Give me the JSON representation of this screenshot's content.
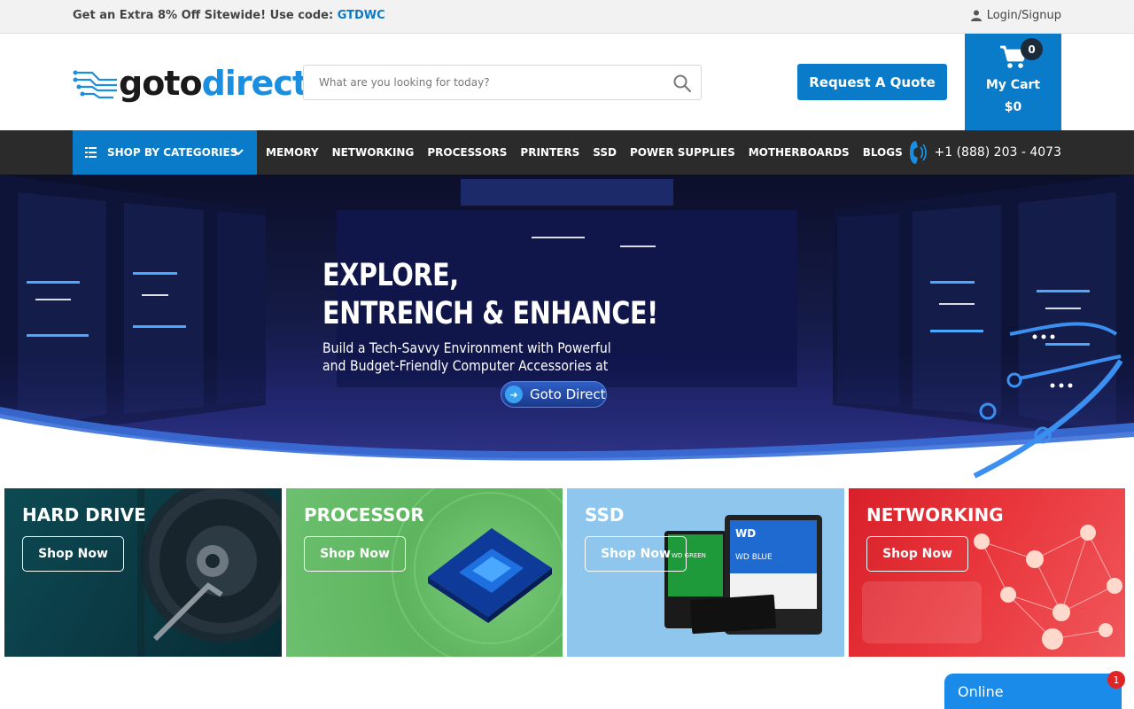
{
  "topbar": {
    "promo_text": "Get an Extra 8% Off Sitewide! Use code: ",
    "promo_code": "GTDWC",
    "login_label": "Login/Signup"
  },
  "header": {
    "logo_goto": "goto",
    "logo_direct": "direct",
    "search_placeholder": "What are you looking for today?",
    "quote_label": "Request A Quote",
    "cart_count": "0",
    "cart_label": "My Cart",
    "cart_total": "$0"
  },
  "nav": {
    "shop_by_categories": "SHOP BY CATEGORIES",
    "links": [
      "MEMORY",
      "NETWORKING",
      "PROCESSORS",
      "PRINTERS",
      "SSD",
      "POWER SUPPLIES",
      "MOTHERBOARDS",
      "BLOGS"
    ],
    "phone": "+1 (888) 203 - 4073"
  },
  "hero": {
    "title_line1": "EXPLORE,",
    "title_line2": "ENTRENCH & ENHANCE!",
    "sub_line1": "Build a Tech-Savvy Environment with Powerful",
    "sub_line2": "and Budget-Friendly Computer Accessories at",
    "cta_label": "Goto Direct"
  },
  "tiles": [
    {
      "title": "HARD DRIVE",
      "button": "Shop Now"
    },
    {
      "title": "PROCESSOR",
      "button": "Shop Now"
    },
    {
      "title": "SSD",
      "button": "Shop Now"
    },
    {
      "title": "NETWORKING",
      "button": "Shop Now"
    }
  ],
  "ssd_image_labels": {
    "wd_blue": "WD BLUE",
    "wd_green": "WD GREEN"
  },
  "chat": {
    "label": "Online",
    "badge": "1"
  },
  "colors": {
    "brand_blue": "#0a7bc8",
    "nav_dark": "#2b2b2b",
    "chat_blue": "#1a8be8"
  }
}
